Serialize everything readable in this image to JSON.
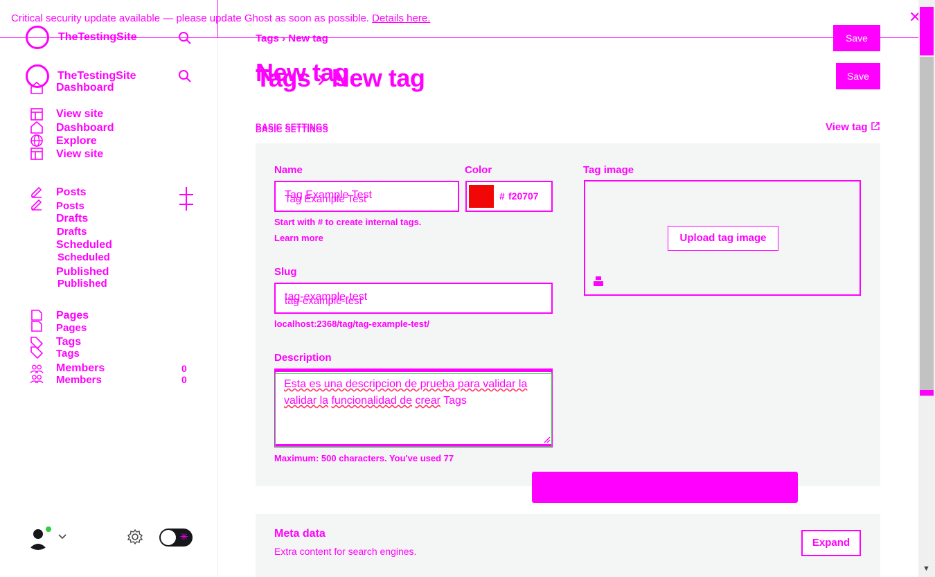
{
  "banner": {
    "message": "Critical security update available — please update Ghost as soon as possible.",
    "link": "Details here.",
    "close_icon": "close-icon"
  },
  "sidebar": {
    "site_name": "TheTestingSite",
    "nav": {
      "dashboard": "Dashboard",
      "view_site": "View site",
      "explore": "Explore",
      "posts": "Posts",
      "drafts": "Drafts",
      "scheduled": "Scheduled",
      "published": "Published",
      "pages": "Pages",
      "tags": "Tags",
      "members": "Members",
      "members_count": "0"
    }
  },
  "header": {
    "breadcrumb_parent": "Tags",
    "breadcrumb_current": "New tag",
    "title": "New tag",
    "save_label": "Save"
  },
  "form": {
    "section_label": "BASIC SETTINGS",
    "view_tag_label": "View tag",
    "name_label": "Name",
    "name_value": "Tag Example Test",
    "name_hint": "Start with # to create internal tags.",
    "name_hint_link": "Learn more",
    "color_label": "Color",
    "color_value": "f20707",
    "color_hex": "#f20707",
    "tag_image_label": "Tag image",
    "upload_label": "Upload tag image",
    "slug_label": "Slug",
    "slug_value": "tag-example-test",
    "slug_url": "localhost:2368/tag/tag-example-test/",
    "description_label": "Description",
    "description_value": "Esta es una descripcion de prueba para validar la funcionalidad de crear Tags",
    "description_line1": "Esta es una descripcion de prueba para validar la",
    "description_line2_a": "validar la",
    "description_line2_b": "funcionalidad de",
    "description_line2_c": "crear",
    "description_line2_d": "Tags",
    "description_hint": "Maximum: 500 characters. You've used 77"
  },
  "meta": {
    "title": "Meta data",
    "subtitle": "Extra content for search engines.",
    "expand_label": "Expand"
  }
}
